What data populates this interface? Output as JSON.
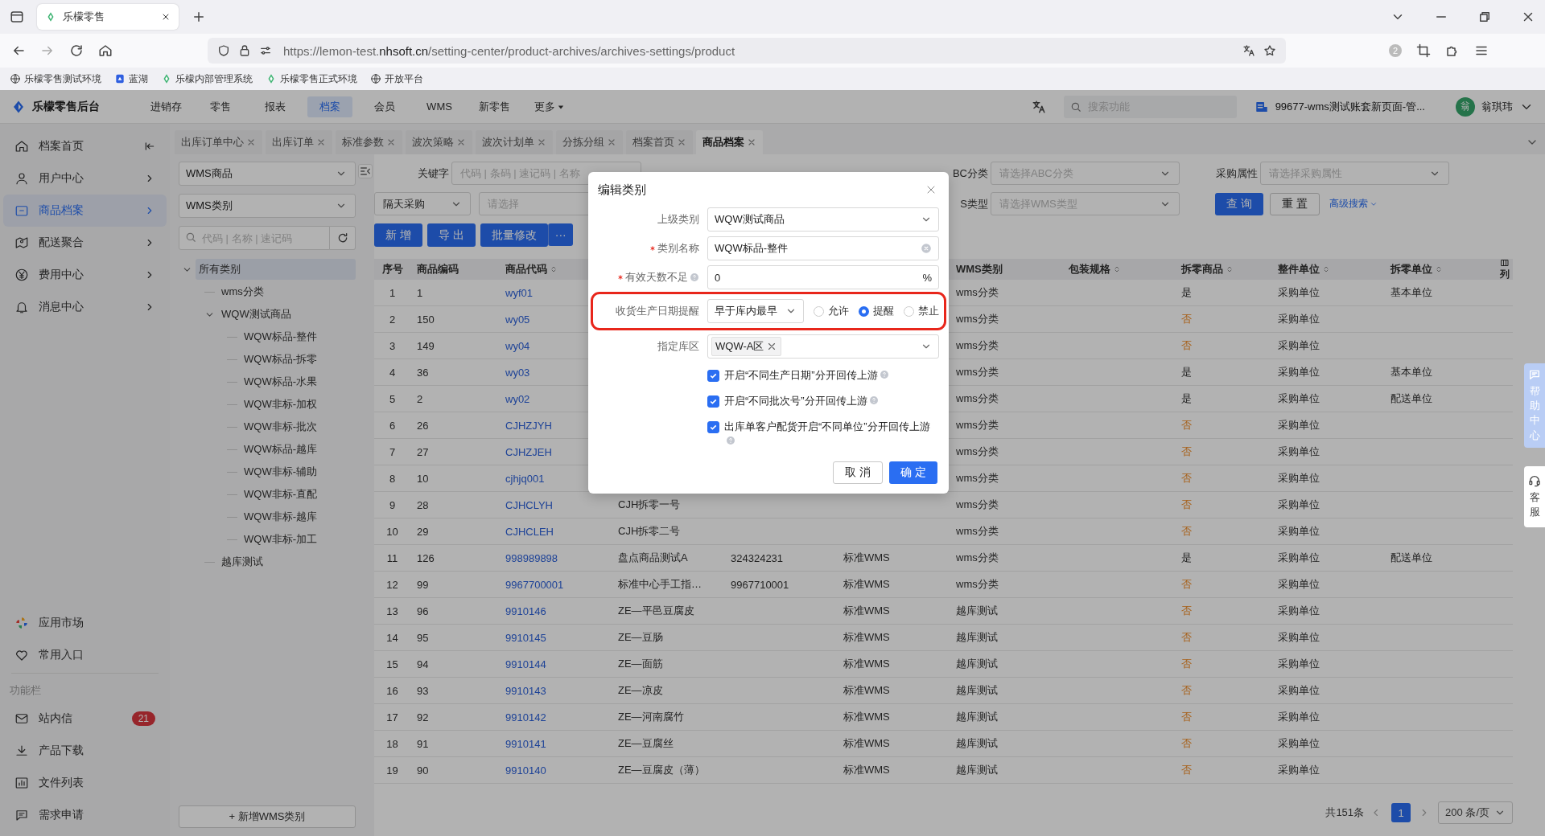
{
  "browser": {
    "tab": {
      "title": "乐檬零售"
    },
    "url": {
      "scheme": "https://lemon-test.",
      "host": "nhsoft.cn",
      "path": "/setting-center/product-archives/archives-settings/product"
    },
    "extension_badge": "2",
    "bookmarks": [
      {
        "label": "乐檬零售测试环境"
      },
      {
        "label": "蓝湖"
      },
      {
        "label": "乐檬内部管理系统"
      },
      {
        "label": "乐檬零售正式环境"
      },
      {
        "label": "开放平台"
      }
    ]
  },
  "header": {
    "brand": "乐檬零售后台",
    "nav": [
      {
        "label": "进销存",
        "selected": false
      },
      {
        "label": "零售",
        "selected": false
      },
      {
        "label": "报表",
        "selected": false
      },
      {
        "label": "档案",
        "selected": true
      },
      {
        "label": "会员",
        "selected": false
      },
      {
        "label": "WMS",
        "selected": false
      },
      {
        "label": "新零售",
        "selected": false
      },
      {
        "label": "更多",
        "selected": false,
        "dropdown": true
      }
    ],
    "search": {
      "placeholder": "搜索功能"
    },
    "store": "99677-wms测试账套新页面-管...",
    "avatar": "翁",
    "user": "翁琪玮"
  },
  "sidebar": {
    "items": [
      {
        "label": "档案首页",
        "selected": false
      },
      {
        "label": "用户中心",
        "selected": false
      },
      {
        "label": "商品档案",
        "selected": true
      },
      {
        "label": "配送聚合",
        "selected": false
      },
      {
        "label": "费用中心",
        "selected": false
      },
      {
        "label": "消息中心",
        "selected": false
      }
    ],
    "shortcuts": [
      {
        "label": "应用市场"
      },
      {
        "label": "常用入口"
      }
    ],
    "section": "功能栏",
    "tools": [
      {
        "label": "站内信",
        "badge": "21"
      },
      {
        "label": "产品下载"
      },
      {
        "label": "文件列表"
      },
      {
        "label": "需求申请"
      }
    ]
  },
  "tabs": [
    {
      "label": "出库订单中心",
      "selected": false
    },
    {
      "label": "出库订单",
      "selected": false
    },
    {
      "label": "标准参数",
      "selected": false
    },
    {
      "label": "波次策略",
      "selected": false
    },
    {
      "label": "波次计划单",
      "selected": false
    },
    {
      "label": "分拣分组",
      "selected": false
    },
    {
      "label": "档案首页",
      "selected": false
    },
    {
      "label": "商品档案",
      "selected": true
    }
  ],
  "category_panel": {
    "product_type": "WMS商品",
    "category_type": "WMS类别",
    "search": {
      "placeholder": "代码 | 名称 | 速记码"
    },
    "tree": [
      {
        "label": "所有类别",
        "selected": true,
        "expanded": true,
        "children": [
          {
            "label": "wms分类",
            "selected": false
          },
          {
            "label": "WQW测试商品",
            "selected": false,
            "expanded": true,
            "children": [
              {
                "label": "WQW标品-整件",
                "selected": false
              },
              {
                "label": "WQW标品-拆零",
                "selected": false
              },
              {
                "label": "WQW标品-水果",
                "selected": false
              },
              {
                "label": "WQW非标-加权",
                "selected": false
              },
              {
                "label": "WQW非标-批次",
                "selected": false
              },
              {
                "label": "WQW标品-越库",
                "selected": false
              },
              {
                "label": "WQW非标-辅助",
                "selected": false
              },
              {
                "label": "WQW非标-直配",
                "selected": false
              },
              {
                "label": "WQW非标-越库",
                "selected": false
              },
              {
                "label": "WQW非标-加工",
                "selected": false
              }
            ]
          },
          {
            "label": "越库测试",
            "selected": false
          }
        ]
      }
    ],
    "add_button": "+ 新增WMS类别"
  },
  "filters": {
    "keyword": {
      "label": "关键字",
      "placeholder": "代码 | 条码 | 速记码 | 名称"
    },
    "abc": {
      "label": "BC分类",
      "placeholder": "请选择ABC分类"
    },
    "purchase": {
      "label": "采购属性",
      "placeholder": "请选择采购属性"
    },
    "purchase_day": {
      "value": "隔天采购"
    },
    "select_2": {
      "placeholder": "请选择"
    },
    "wms_type": {
      "label": "S类型",
      "placeholder": "请选择WMS类型"
    },
    "query": "查 询",
    "reset": "重 置",
    "advanced": "高级搜索"
  },
  "toolbar": {
    "buttons": [
      "新 增",
      "导 出",
      "批量修改"
    ],
    "more": "···"
  },
  "table": {
    "columns": [
      {
        "label": "序号",
        "sortable": false
      },
      {
        "label": "商品编码",
        "sortable": false
      },
      {
        "label": "商品代码",
        "sortable": true,
        "kind": "link"
      },
      {
        "kind": "text"
      },
      {
        "kind": "text"
      },
      {
        "kind": "text"
      },
      {
        "label": "WMS类别",
        "sortable": false
      },
      {
        "label": "包装规格",
        "sortable": true
      },
      {
        "label": "拆零商品",
        "sortable": true,
        "kind": "flag"
      },
      {
        "label": "整件单位",
        "sortable": true
      },
      {
        "label": "拆零单位",
        "sortable": true
      }
    ],
    "column_settings": "列",
    "rows": [
      {
        "no": "1",
        "num": "1",
        "code": "wyf01",
        "wms_cat": "wms分类",
        "split": "是",
        "split_warn": false,
        "whole_unit": "采购单位",
        "split_unit": "基本单位"
      },
      {
        "no": "2",
        "num": "150",
        "code": "wy05",
        "wms_cat": "wms分类",
        "split": "否",
        "split_warn": true,
        "whole_unit": "采购单位"
      },
      {
        "no": "3",
        "num": "149",
        "code": "wy04",
        "wms_cat": "wms分类",
        "split": "否",
        "split_warn": true,
        "whole_unit": "采购单位"
      },
      {
        "no": "4",
        "num": "36",
        "code": "wy03",
        "wms_cat": "wms分类",
        "split": "是",
        "split_warn": false,
        "whole_unit": "采购单位",
        "split_unit": "基本单位"
      },
      {
        "no": "5",
        "num": "2",
        "code": "wy02",
        "wms_cat": "wms分类",
        "split": "是",
        "split_warn": false,
        "whole_unit": "采购单位",
        "split_unit": "配送单位"
      },
      {
        "no": "6",
        "num": "26",
        "code": "CJHZJYH",
        "wms_cat": "wms分类",
        "split": "否",
        "split_warn": true,
        "whole_unit": "采购单位"
      },
      {
        "no": "7",
        "num": "27",
        "code": "CJHZJEH",
        "wms_cat": "wms分类",
        "split": "否",
        "split_warn": true,
        "whole_unit": "采购单位"
      },
      {
        "no": "8",
        "num": "10",
        "code": "cjhjq001",
        "wms_cat": "wms分类",
        "split": "否",
        "split_warn": true,
        "whole_unit": "采购单位"
      },
      {
        "no": "9",
        "num": "28",
        "code": "CJHCLYH",
        "column_4": "CJH拆零一号",
        "wms_cat": "wms分类",
        "split": "否",
        "split_warn": true,
        "whole_unit": "采购单位"
      },
      {
        "no": "10",
        "num": "29",
        "code": "CJHCLEH",
        "column_4": "CJH拆零二号",
        "wms_cat": "wms分类",
        "split": "否",
        "split_warn": true,
        "whole_unit": "采购单位"
      },
      {
        "no": "11",
        "num": "126",
        "code": "998989898",
        "column_4": "盘点商品测试A",
        "column_5": "324324231",
        "column_6": "标准WMS",
        "wms_cat": "wms分类",
        "split": "是",
        "split_warn": false,
        "whole_unit": "采购单位",
        "split_unit": "配送单位"
      },
      {
        "no": "12",
        "num": "99",
        "code": "9967700001",
        "column_4": "标准中心手工指…",
        "column_5": "9967710001",
        "column_6": "标准WMS",
        "wms_cat": "wms分类",
        "split": "否",
        "split_warn": true,
        "whole_unit": "采购单位"
      },
      {
        "no": "13",
        "num": "96",
        "code": "9910146",
        "column_4": "ZE—平邑豆腐皮",
        "column_6": "标准WMS",
        "wms_cat": "越库测试",
        "split": "否",
        "split_warn": true,
        "whole_unit": "采购单位"
      },
      {
        "no": "14",
        "num": "95",
        "code": "9910145",
        "column_4": "ZE—豆肠",
        "column_6": "标准WMS",
        "wms_cat": "越库测试",
        "split": "否",
        "split_warn": true,
        "whole_unit": "采购单位"
      },
      {
        "no": "15",
        "num": "94",
        "code": "9910144",
        "column_4": "ZE—面筋",
        "column_6": "标准WMS",
        "wms_cat": "越库测试",
        "split": "否",
        "split_warn": true,
        "whole_unit": "采购单位"
      },
      {
        "no": "16",
        "num": "93",
        "code": "9910143",
        "column_4": "ZE—凉皮",
        "column_6": "标准WMS",
        "wms_cat": "越库测试",
        "split": "否",
        "split_warn": true,
        "whole_unit": "采购单位"
      },
      {
        "no": "17",
        "num": "92",
        "code": "9910142",
        "column_4": "ZE—河南腐竹",
        "column_6": "标准WMS",
        "wms_cat": "越库测试",
        "split": "否",
        "split_warn": true,
        "whole_unit": "采购单位"
      },
      {
        "no": "18",
        "num": "91",
        "code": "9910141",
        "column_4": "ZE—豆腐丝",
        "column_6": "标准WMS",
        "wms_cat": "越库测试",
        "split": "否",
        "split_warn": true,
        "whole_unit": "采购单位"
      },
      {
        "no": "19",
        "num": "90",
        "code": "9910140",
        "column_4": "ZE—豆腐皮（薄）",
        "column_6": "标准WMS",
        "wms_cat": "越库测试",
        "split": "否",
        "split_warn": true,
        "whole_unit": "采购单位"
      }
    ]
  },
  "pagination": {
    "total": "共151条",
    "pages": [
      {
        "label": "1",
        "selected": true
      }
    ],
    "page_size": "200 条/页"
  },
  "floats": {
    "help": "帮助中心",
    "service": "客服"
  },
  "modal": {
    "title": "编辑类别",
    "fields": [
      {
        "kind": "select",
        "label": "上级类别",
        "required": false,
        "value": "WQW测试商品"
      },
      {
        "kind": "input",
        "label": "类别名称",
        "required": true,
        "value": "WQW标品-整件",
        "clearable": true
      },
      {
        "kind": "percent",
        "label": "有效天数不足",
        "required": true,
        "help": true,
        "value": "0",
        "suffix": "%"
      },
      {
        "kind": "select_radios",
        "label": "收货生产日期提醒",
        "required": false,
        "highlighted": true,
        "value": "早于库内最早",
        "options": [
          {
            "label": "允许",
            "selected": false
          },
          {
            "label": "提醒",
            "selected": true
          },
          {
            "label": "禁止",
            "selected": false
          }
        ]
      },
      {
        "kind": "tags",
        "label": "指定库区",
        "required": false,
        "tags": [
          "WQW-A区"
        ]
      },
      {
        "kind": "checkbox",
        "label": "开启“不同生产日期”分开回传上游",
        "checked": true,
        "help": true
      },
      {
        "kind": "checkbox",
        "label": "开启“不同批次号”分开回传上游",
        "checked": true,
        "help": true
      },
      {
        "kind": "checkbox",
        "label": "出库单客户配货开启“不同单位”分开回传上游",
        "checked": true,
        "help": true
      }
    ],
    "cancel": "取 消",
    "ok": "确 定"
  }
}
